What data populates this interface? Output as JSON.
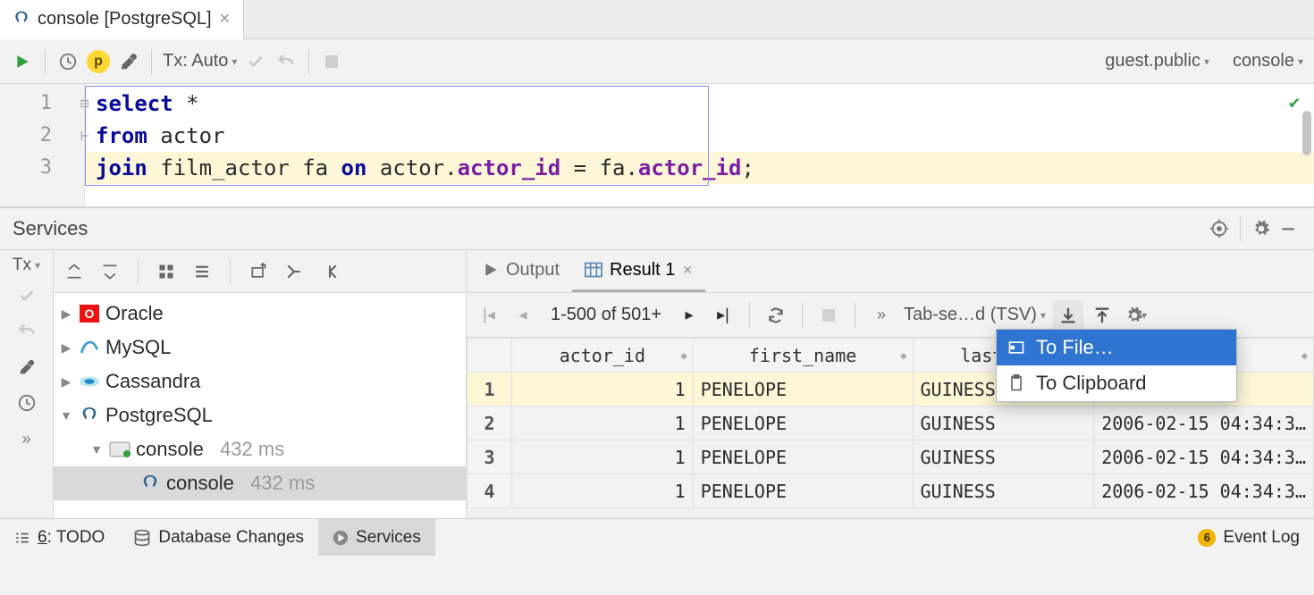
{
  "tab": {
    "title": "console [PostgreSQL]"
  },
  "toolbar": {
    "tx_label": "Tx: Auto",
    "schema": "guest.public",
    "console": "console"
  },
  "editor": {
    "lines": [
      "1",
      "2",
      "3"
    ],
    "code": {
      "l1_kw": "select",
      "l1_rest": " *",
      "l2_kw": "from",
      "l2_rest": " actor",
      "l3_kw1": "join",
      "l3_tbl": " film_actor fa ",
      "l3_kw2": "on",
      "l3_a": " actor.",
      "l3_col1": "actor_id",
      "l3_eq": " = fa.",
      "l3_col2": "actor_id",
      "l3_semi": ";"
    }
  },
  "services": {
    "title": "Services",
    "tx_label": "Tx",
    "tree": [
      {
        "name": "Oracle",
        "icon": "oracle",
        "expanded": false,
        "depth": 0
      },
      {
        "name": "MySQL",
        "icon": "mysql",
        "expanded": false,
        "depth": 0
      },
      {
        "name": "Cassandra",
        "icon": "cassandra",
        "expanded": false,
        "depth": 0
      },
      {
        "name": "PostgreSQL",
        "icon": "postgres",
        "expanded": true,
        "depth": 0
      },
      {
        "name": "console",
        "icon": "console",
        "expanded": true,
        "depth": 1,
        "suffix": "432 ms"
      },
      {
        "name": "console",
        "icon": "postgres",
        "expanded": null,
        "depth": 2,
        "suffix": "432 ms",
        "selected": true
      }
    ]
  },
  "results": {
    "tabs": {
      "output": "Output",
      "result": "Result 1"
    },
    "page_info": "1-500 of 501+",
    "export_format": "Tab-se…d (TSV)",
    "popup": {
      "to_file": "To File…",
      "to_clipboard": "To Clipboard"
    },
    "columns": [
      "actor_id",
      "first_name",
      "last_na…",
      ""
    ],
    "rows": [
      {
        "n": "1",
        "actor_id": "1",
        "first_name": "PENELOPE",
        "last_name": "GUINESS",
        "ts": "4:34:3…"
      },
      {
        "n": "2",
        "actor_id": "1",
        "first_name": "PENELOPE",
        "last_name": "GUINESS",
        "ts": "2006-02-15 04:34:3…"
      },
      {
        "n": "3",
        "actor_id": "1",
        "first_name": "PENELOPE",
        "last_name": "GUINESS",
        "ts": "2006-02-15 04:34:3…"
      },
      {
        "n": "4",
        "actor_id": "1",
        "first_name": "PENELOPE",
        "last_name": "GUINESS",
        "ts": "2006-02-15 04:34:3…"
      }
    ]
  },
  "status": {
    "todo_underline": "6",
    "todo": ": TODO",
    "db_changes": "Database Changes",
    "services": "Services",
    "event_log": "Event Log",
    "event_count": "6"
  }
}
